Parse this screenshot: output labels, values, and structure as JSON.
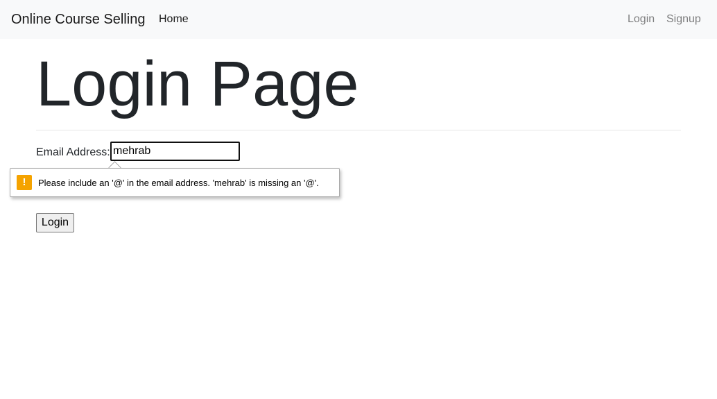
{
  "navbar": {
    "brand": "Online Course Selling",
    "home": "Home",
    "login": "Login",
    "signup": "Signup"
  },
  "page": {
    "title": "Login Page"
  },
  "form": {
    "email_label": "Email Address:",
    "email_value": "mehrab",
    "login_button": "Login"
  },
  "validation": {
    "icon": "warning-icon",
    "icon_color": "#f5a300",
    "message": "Please include an '@' in the email address. 'mehrab' is missing an '@'."
  }
}
